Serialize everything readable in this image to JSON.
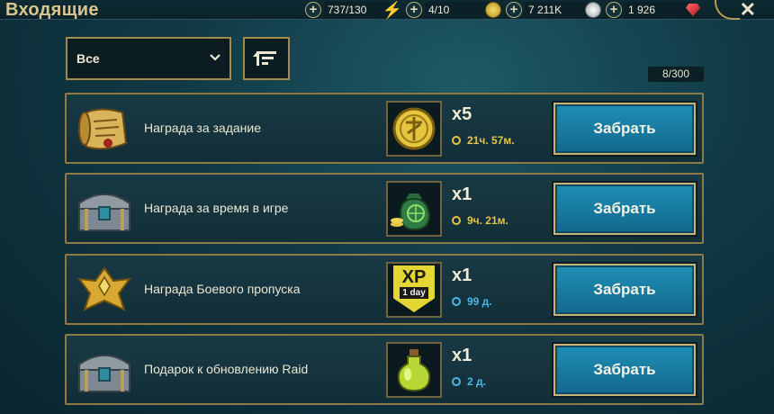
{
  "header": {
    "title": "Входящие",
    "resources": [
      {
        "value": "737/130",
        "icon": "energy-bolt-icon"
      },
      {
        "value": "4/10",
        "icon": "arena-token-icon"
      },
      {
        "value": "7 211K",
        "icon": "silver-coin-icon"
      },
      {
        "value": "1 926",
        "icon": "ruby-gem-icon"
      }
    ]
  },
  "controls": {
    "filter_label": "Все",
    "counter": "8/300"
  },
  "colors": {
    "gold_timer": "#e7c34a",
    "blue_timer": "#49b6e6",
    "claim_button": "#1a7fa6",
    "frame": "#8d7a46"
  },
  "rows": [
    {
      "label": "Награда за задание",
      "qty": "x5",
      "timer": "21ч. 57м.",
      "timer_color": "gold",
      "button": "Забрать",
      "icon": "scroll-icon",
      "item_icon": "gold-token-icon"
    },
    {
      "label": "Награда за время в игре",
      "qty": "x1",
      "timer": "9ч. 21м.",
      "timer_color": "gold",
      "button": "Забрать",
      "icon": "chest-icon",
      "item_icon": "money-bag-icon"
    },
    {
      "label": "Награда Боевого пропуска",
      "qty": "x1",
      "timer": "99 д.",
      "timer_color": "blue",
      "button": "Забрать",
      "icon": "battle-pass-emblem-icon",
      "item_icon": "xp-boost-icon",
      "xp_text": "XP",
      "xp_sub": "1 day"
    },
    {
      "label": "Подарок к обновлению Raid",
      "qty": "x1",
      "timer": "2 д.",
      "timer_color": "blue",
      "button": "Забрать",
      "icon": "chest-icon",
      "item_icon": "potion-icon"
    }
  ]
}
